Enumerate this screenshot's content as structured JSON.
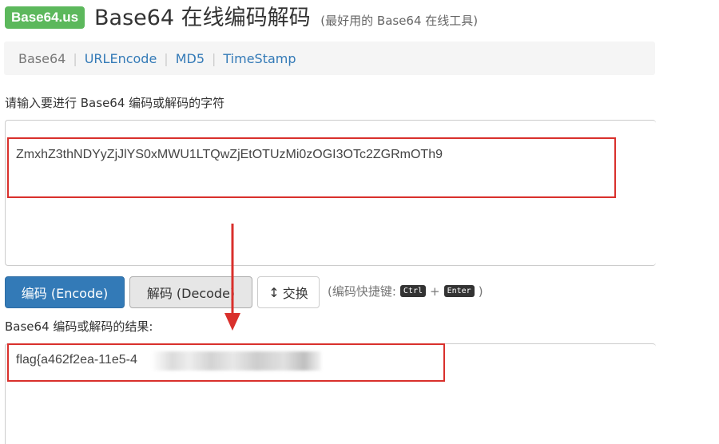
{
  "header": {
    "logo_text": "Base64.us",
    "title": "Base64 在线编码解码",
    "subtitle": "(最好用的 Base64 在线工具)"
  },
  "nav": {
    "items": [
      {
        "label": "Base64"
      },
      {
        "label": "URLEncode"
      },
      {
        "label": "MD5"
      },
      {
        "label": "TimeStamp"
      }
    ],
    "separator": "|"
  },
  "input": {
    "label": "请输入要进行 Base64 编码或解码的字符",
    "value": "ZmxhZ3thNDYyZjJlYS0xMWU1LTQwZjEtOTUzMi0zOGI3OTc2ZGRmOTh9"
  },
  "buttons": {
    "encode": "编码 (Encode)",
    "decode": "解码 (Decode)",
    "swap": "交换"
  },
  "shortcut": {
    "prefix": "(编码快捷键:",
    "key1": "Ctrl",
    "plus": "+",
    "key2": "Enter",
    "suffix": ")"
  },
  "output": {
    "label": "Base64 编码或解码的结果:",
    "value_visible": "flag{a462f2ea-11e5-4"
  },
  "colors": {
    "accent": "#337ab7",
    "logo": "#5cb85c",
    "highlight": "#d9302c"
  },
  "icons": {
    "swap": "up-down-arrows-icon"
  }
}
